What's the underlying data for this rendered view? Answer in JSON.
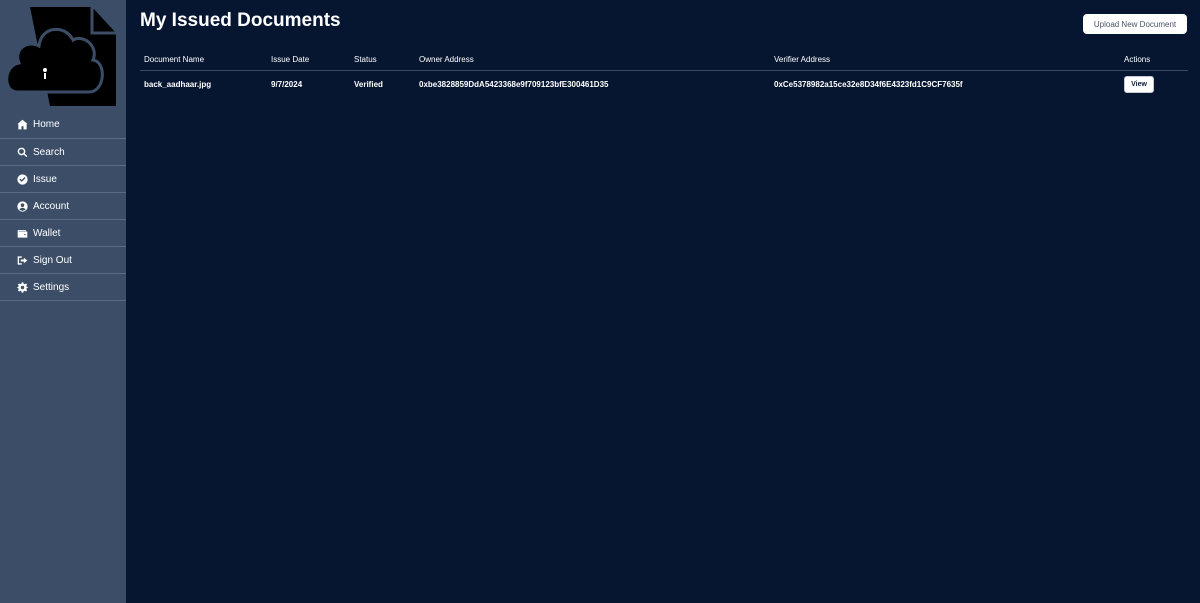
{
  "sidebar": {
    "items": [
      {
        "label": "Home",
        "icon": "home-icon"
      },
      {
        "label": "Search",
        "icon": "search-icon"
      },
      {
        "label": "Issue",
        "icon": "check-circle-icon"
      },
      {
        "label": "Account",
        "icon": "user-circle-icon"
      },
      {
        "label": "Wallet",
        "icon": "wallet-icon"
      },
      {
        "label": "Sign Out",
        "icon": "sign-out-icon"
      },
      {
        "label": "Settings",
        "icon": "gear-icon"
      }
    ]
  },
  "main": {
    "title": "My Issued Documents",
    "upload_label": "Upload New Document",
    "table": {
      "headers": [
        "Document Name",
        "Issue Date",
        "Status",
        "Owner Address",
        "Verifier Address",
        "Actions"
      ],
      "rows": [
        {
          "name": "back_aadhaar.jpg",
          "date": "9/7/2024",
          "status": "Verified",
          "owner": "0xbe3828859DdA5423368e9f709123bfE300461D35",
          "verifier": "0xCe5378982a15ce32e8D34f6E4323fd1C9CF7635f",
          "action": "View"
        }
      ]
    }
  },
  "colors": {
    "background": "#061631",
    "sidebar": "#3c4d67",
    "text": "#ffffff"
  }
}
